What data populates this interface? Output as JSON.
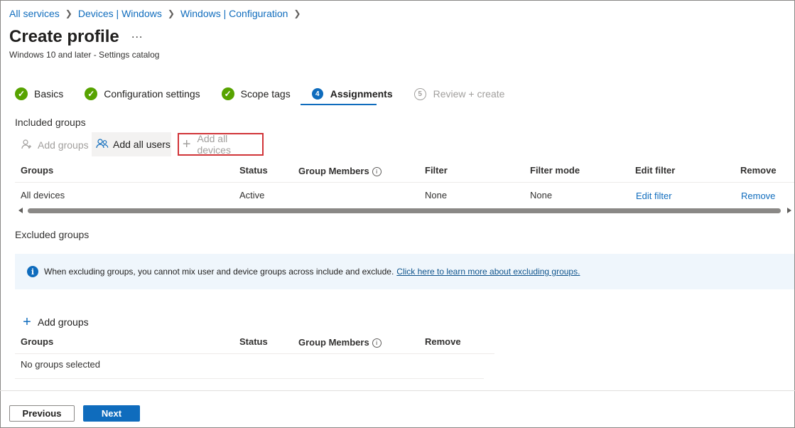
{
  "breadcrumb": [
    "All services",
    "Devices | Windows",
    "Windows | Configuration"
  ],
  "page": {
    "title": "Create profile",
    "more": "...",
    "subtitle": "Windows 10 and later - Settings catalog"
  },
  "steps": [
    {
      "label": "Basics",
      "state": "done"
    },
    {
      "label": "Configuration settings",
      "state": "done"
    },
    {
      "label": "Scope tags",
      "state": "done"
    },
    {
      "label": "Assignments",
      "number": "4",
      "state": "active"
    },
    {
      "label": "Review + create",
      "number": "5",
      "state": "disabled"
    }
  ],
  "included": {
    "label": "Included groups",
    "add_groups": "Add groups",
    "add_all_users": "Add all users",
    "add_all_devices": "Add all devices",
    "columns": [
      "Groups",
      "Status",
      "Group Members",
      "Filter",
      "Filter mode",
      "Edit filter",
      "Remove"
    ],
    "rows": [
      {
        "group": "All devices",
        "status": "Active",
        "members": "",
        "filter": "None",
        "filter_mode": "None",
        "edit_filter": "Edit filter",
        "remove": "Remove"
      }
    ]
  },
  "excluded": {
    "label": "Excluded groups",
    "info": "When excluding groups, you cannot mix user and device groups across include and exclude.",
    "info_link": "Click here to learn more about excluding groups.",
    "add_groups": "Add groups",
    "columns": [
      "Groups",
      "Status",
      "Group Members",
      "Remove"
    ],
    "empty": "No groups selected"
  },
  "footer": {
    "previous": "Previous",
    "next": "Next"
  },
  "colors": {
    "accent": "#0f6cbd",
    "done": "#57a300",
    "highlight": "#d13438"
  }
}
